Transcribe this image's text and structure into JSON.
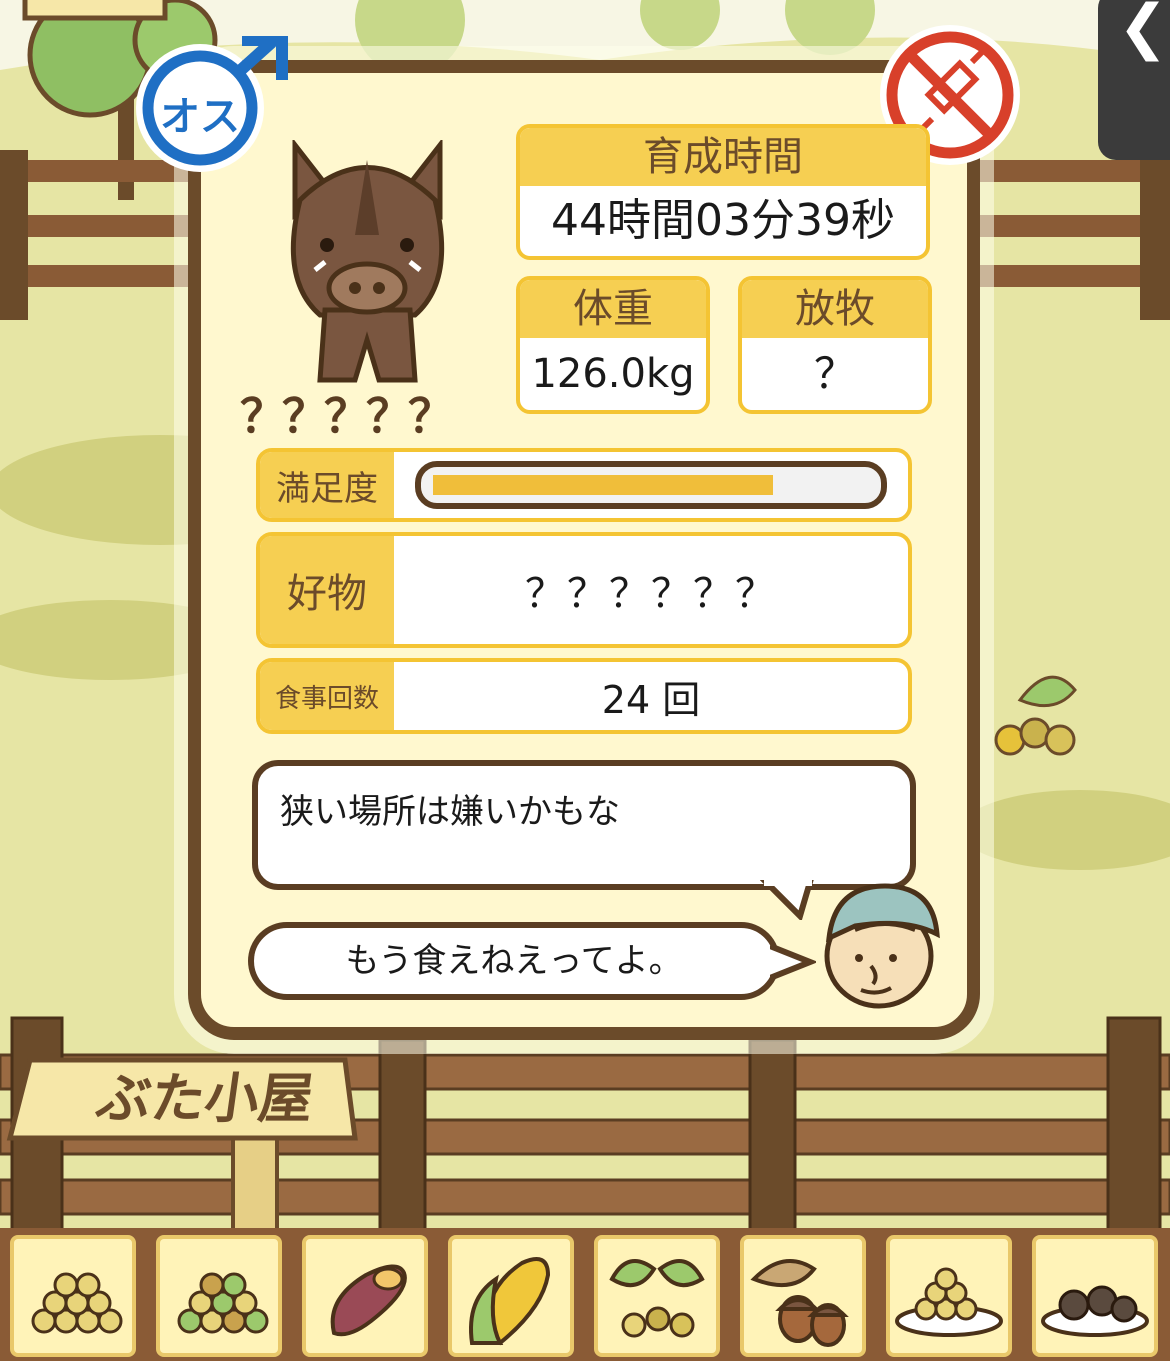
{
  "gender_badge": {
    "label": "オス",
    "icon": "male-symbol-icon"
  },
  "vaccine_icon": "no-syringe-icon",
  "pig": {
    "name": "？？？？？"
  },
  "stats": {
    "growth_time_label": "育成時間",
    "growth_time_value": "44時間03分39秒",
    "weight_label": "体重",
    "weight_value": "126.0kg",
    "grazing_label": "放牧",
    "grazing_value": "？"
  },
  "satisfaction": {
    "label": "満足度",
    "level": 0.78
  },
  "favorite": {
    "label": "好物",
    "value": "？？？？？？"
  },
  "meals": {
    "label": "食事回数",
    "value": "24 回"
  },
  "message": "狭い場所は嫌いかもな",
  "farmer_speech": "もう食えねえってよ。",
  "sign": "ぶた小屋",
  "back_button": "❮",
  "colors": {
    "panel_border": "#6b4b2a",
    "accent": "#f4c433",
    "label_bg": "#f6cf52",
    "gender_blue": "#1f6fc4",
    "no_red": "#d8402a"
  },
  "food_items": [
    "soybean-pile-icon",
    "mixed-beans-icon",
    "sweet-potato-icon",
    "corn-icon",
    "leaf-beans-icon",
    "acorn-icon",
    "bean-plate-icon",
    "dark-balls-plate-icon"
  ]
}
